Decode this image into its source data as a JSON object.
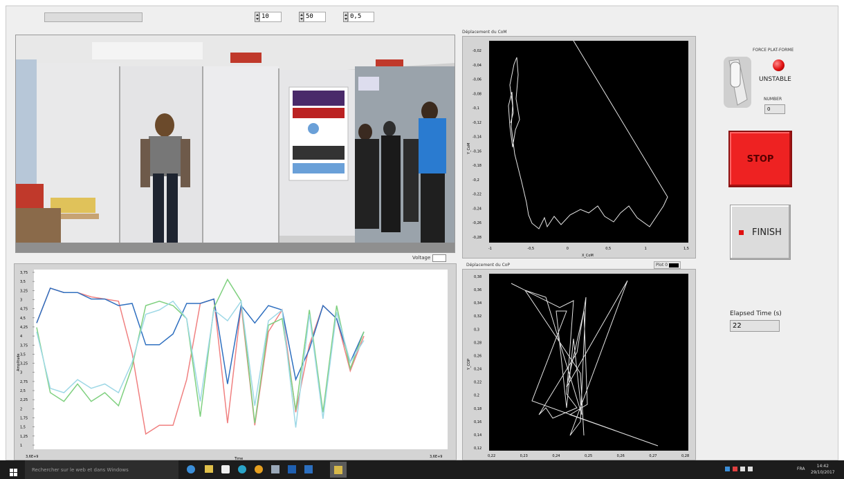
{
  "controls": {
    "num1": "10",
    "num2": "50",
    "num3": "0,5"
  },
  "video_legend": "Voltage",
  "amplitude_graph": {
    "ylabel": "Amplitude",
    "xlabel": "Time",
    "y_ticks": [
      "3,75",
      "3,5",
      "3,25",
      "3",
      "4,75",
      "4,5",
      "4,25",
      "4",
      "3,75",
      "3,5",
      "3,25",
      "3",
      "2,75",
      "2,5",
      "2,25",
      "2",
      "1,75",
      "1,5",
      "1,25",
      "1"
    ],
    "x_start": "3,6E+9",
    "x_end": "3,6E+9",
    "series": [
      {
        "name": "red",
        "color": "#f08080",
        "values": [
          3.9,
          4.7,
          4.6,
          4.6,
          4.5,
          4.45,
          4.4,
          3.2,
          1.35,
          1.55,
          1.55,
          2.6,
          4.35,
          4.45,
          1.6,
          4.3,
          1.55,
          3.7,
          4.2,
          1.85,
          3.4,
          4.3,
          4.0,
          2.8,
          3.6
        ]
      },
      {
        "name": "blue",
        "color": "#2e6fbf",
        "values": [
          3.9,
          4.7,
          4.6,
          4.6,
          4.45,
          4.45,
          4.3,
          4.35,
          3.4,
          3.4,
          3.65,
          4.35,
          4.35,
          4.45,
          2.5,
          4.3,
          3.9,
          4.3,
          4.2,
          2.6,
          3.3,
          4.3,
          4.0,
          3.0,
          3.7
        ]
      },
      {
        "name": "green",
        "color": "#7fd07f",
        "values": [
          3.8,
          2.3,
          2.1,
          2.5,
          2.1,
          2.3,
          2.0,
          2.9,
          4.3,
          4.4,
          4.3,
          4.0,
          1.75,
          4.25,
          4.9,
          4.4,
          1.6,
          3.85,
          4.0,
          1.9,
          4.2,
          1.85,
          4.3,
          2.85,
          3.7
        ]
      },
      {
        "name": "lightblue",
        "color": "#9ed8e6",
        "values": [
          3.7,
          2.4,
          2.3,
          2.6,
          2.4,
          2.5,
          2.3,
          3.0,
          4.1,
          4.2,
          4.4,
          4.0,
          2.1,
          4.2,
          3.95,
          4.4,
          2.0,
          3.95,
          4.2,
          1.5,
          4.1,
          1.7,
          4.15,
          3.0,
          3.5
        ]
      }
    ]
  },
  "scatter1": {
    "title": "Déplacement du CoM",
    "xlabel": "X_CoM",
    "ylabel": "Y_CoM",
    "y_ticks": [
      "-0,02",
      "-0,04",
      "-0,06",
      "-0,08",
      "-0,1",
      "-0,12",
      "-0,14",
      "-0,16",
      "-0,18",
      "-0,2",
      "-0,22",
      "-0,24",
      "-0,26",
      "-0,28"
    ],
    "x_ticks": [
      "-1",
      "-0,5",
      "0",
      "0,5",
      "1",
      "1,5"
    ]
  },
  "scatter2": {
    "title": "Déplacement du CoP",
    "legend": "Plot 0",
    "ylabel": "Y_COP",
    "y_ticks": [
      "0,38",
      "0,36",
      "0,34",
      "0,32",
      "0,3",
      "0,28",
      "0,26",
      "0,24",
      "0,22",
      "0,2",
      "0,18",
      "0,16",
      "0,14",
      "0,12"
    ],
    "x_ticks": [
      "0,22",
      "0,23",
      "0,24",
      "0,25",
      "0,26",
      "0,27",
      "0,28"
    ]
  },
  "right_panel": {
    "force_label": "FORCE PLAT-FORME",
    "status": "UNSTABLE",
    "number_label": "NUMBER",
    "number_value": "0",
    "stop_label": "STOP",
    "finish_label": "FINISH",
    "elapsed_label": "Elapsed Time (s)",
    "elapsed_value": "22",
    "led_color": "#e01010",
    "stop_color": "#ee2222"
  },
  "taskbar": {
    "search_placeholder": "Rechercher sur le web et dans Windows",
    "lang": "FRA",
    "time": "14:42",
    "date": "29/10/2017"
  }
}
